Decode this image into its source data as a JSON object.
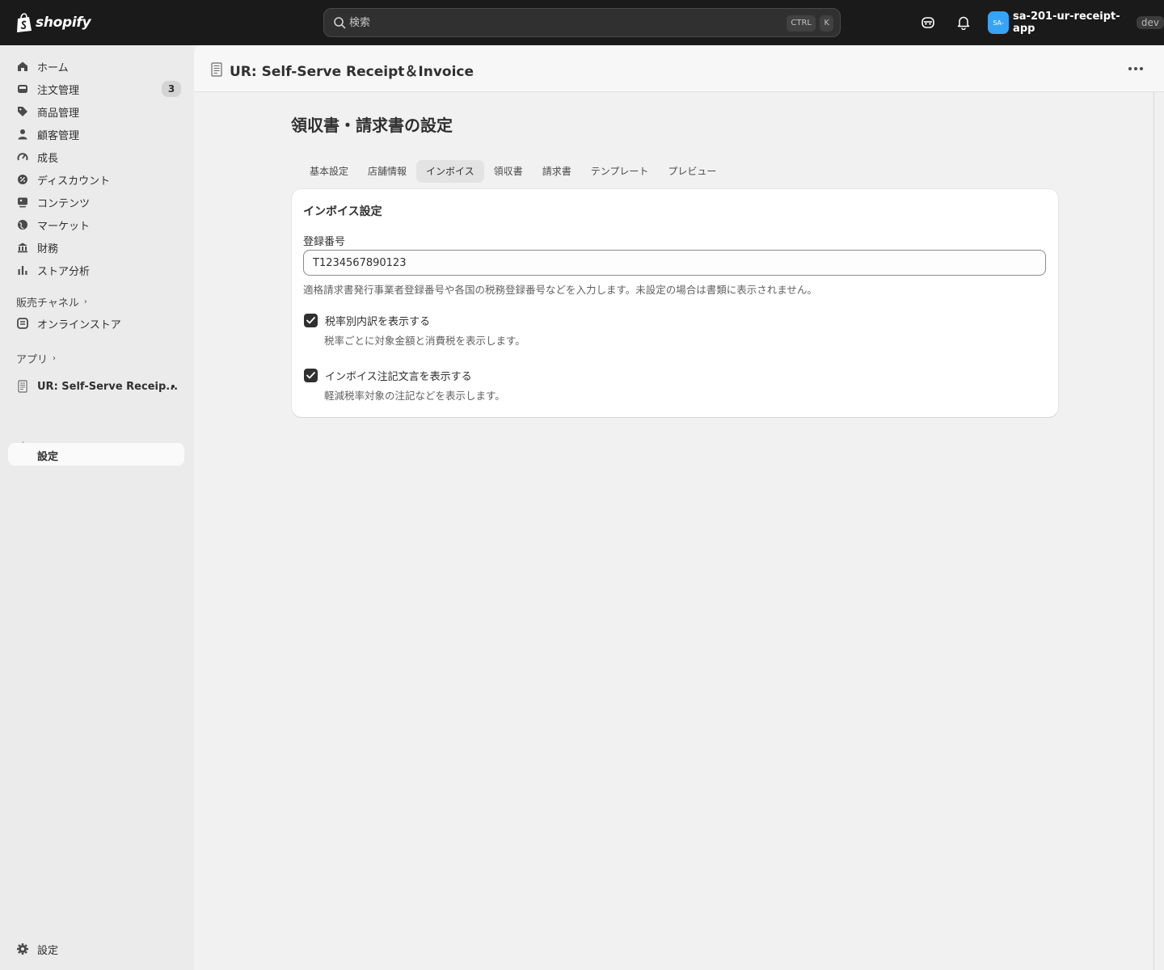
{
  "topbar": {
    "logo_text": "shopify",
    "search_placeholder": "検索",
    "kbd_ctrl": "CTRL",
    "kbd_k": "K",
    "avatar_initials": "SA-",
    "account_name": "sa-201-ur-receipt-app",
    "env_badge": "dev"
  },
  "sidebar": {
    "items": [
      {
        "label": "ホーム",
        "icon": "home-icon"
      },
      {
        "label": "注文管理",
        "icon": "inbox-icon",
        "badge": "3"
      },
      {
        "label": "商品管理",
        "icon": "tag-icon"
      },
      {
        "label": "顧客管理",
        "icon": "person-icon"
      },
      {
        "label": "成長",
        "icon": "gauge-icon"
      },
      {
        "label": "ディスカウント",
        "icon": "discount-icon"
      },
      {
        "label": "コンテンツ",
        "icon": "image-icon"
      },
      {
        "label": "マーケット",
        "icon": "globe-icon"
      },
      {
        "label": "財務",
        "icon": "bank-icon"
      },
      {
        "label": "ストア分析",
        "icon": "chart-icon"
      }
    ],
    "sales_channels_label": "販売チャネル",
    "online_store_label": "オンラインストア",
    "apps_label": "アプリ",
    "app_item_label": "UR: Self-Serve Receip...",
    "app_sub_label": "設定",
    "settings_label": "設定"
  },
  "main": {
    "app_title": "UR: Self-Serve Receipt＆Invoice",
    "page_heading": "領収書・請求書の設定",
    "tabs": [
      "基本設定",
      "店舗情報",
      "インボイス",
      "領収書",
      "請求書",
      "テンプレート",
      "プレビュー"
    ],
    "active_tab": "インボイス",
    "card": {
      "title": "インボイス設定",
      "field_label": "登録番号",
      "field_value": "T1234567890123",
      "field_help": "適格請求書発行事業者登録番号や各国の税務登録番号などを入力します。未設定の場合は書類に表示されません。",
      "check1_label": "税率別内訳を表示する",
      "check1_help": "税率ごとに対象金額と消費税を表示します。",
      "check1_checked": true,
      "check2_label": "インボイス注記文言を表示する",
      "check2_help": "軽減税率対象の注記などを表示します。",
      "check2_checked": true
    }
  },
  "colors": {
    "topbar_bg": "#1a1a1a",
    "sidebar_bg": "#ebebeb",
    "avatar_bg": "#36a3f7",
    "checkbox_bg": "#303030"
  }
}
